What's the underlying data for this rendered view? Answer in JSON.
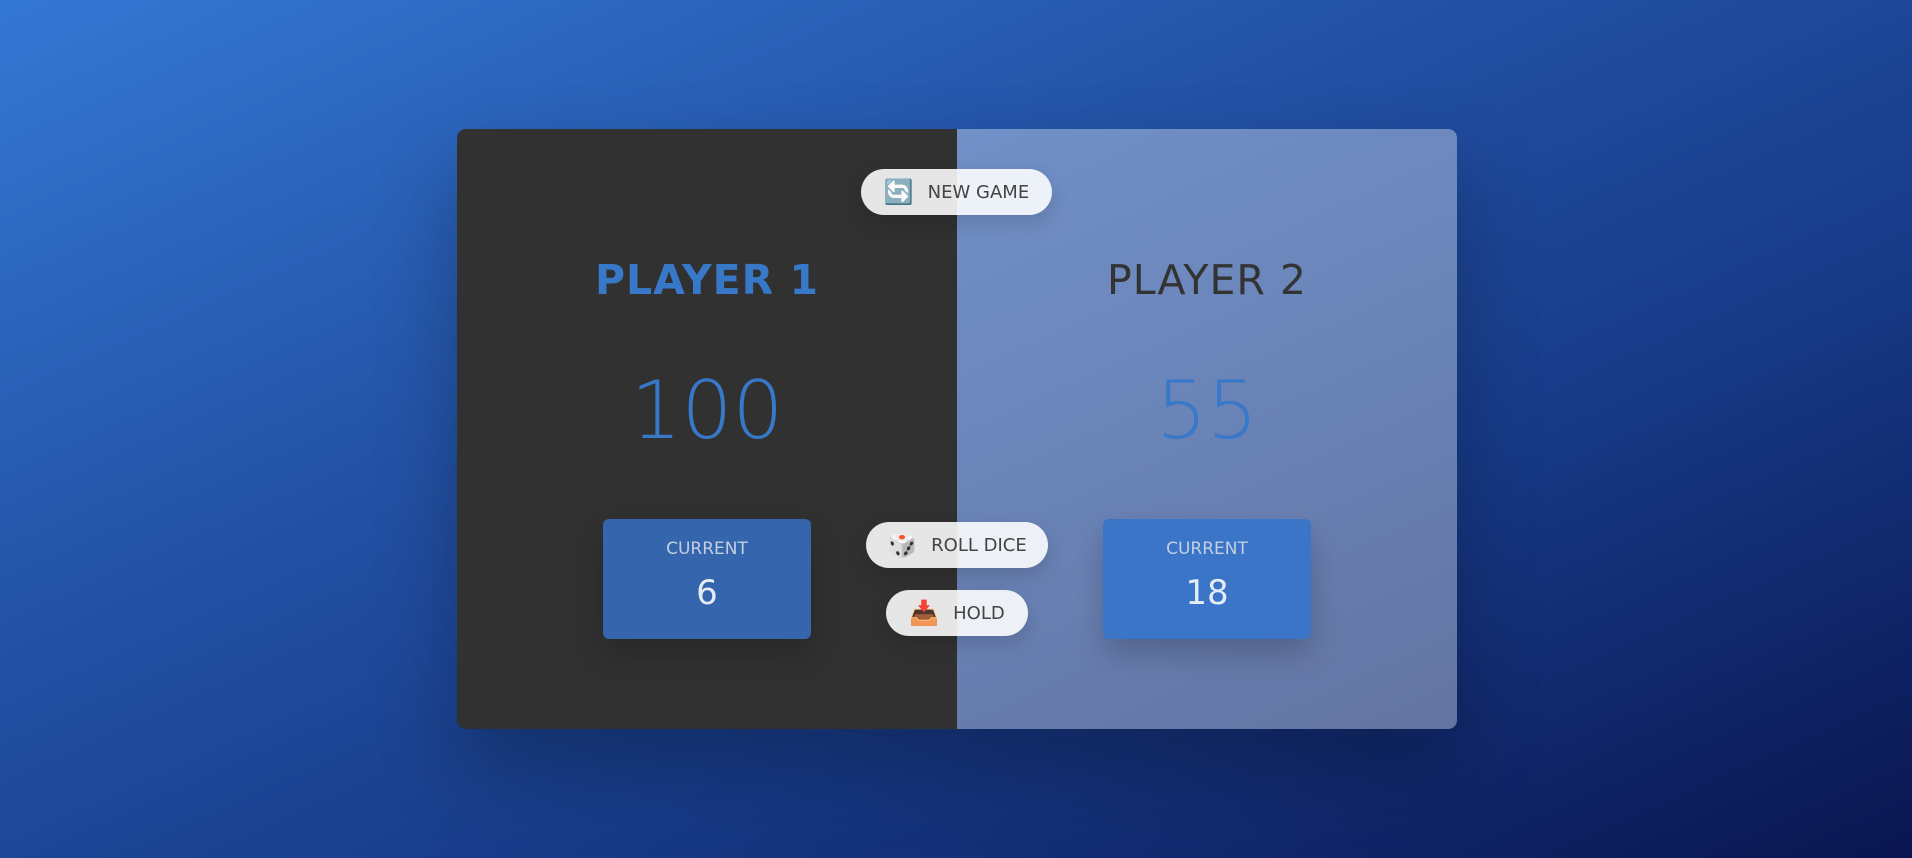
{
  "players": [
    {
      "name": "PLAYER 1",
      "score": "100",
      "current_label": "CURRENT",
      "current_score": "6",
      "active": false
    },
    {
      "name": "PLAYER 2",
      "score": "55",
      "current_label": "CURRENT",
      "current_score": "18",
      "active": true
    }
  ],
  "buttons": {
    "new_game": {
      "label": "NEW GAME",
      "icon": "🔄",
      "icon_name": "refresh-icon"
    },
    "roll_dice": {
      "label": "ROLL DICE",
      "icon": "🎲",
      "icon_name": "dice-icon"
    },
    "hold": {
      "label": "HOLD",
      "icon": "📥",
      "icon_name": "inbox-tray-icon"
    }
  },
  "colors": {
    "accent": "#3778c9",
    "panel_dark": "#313131",
    "current_box": "#3a75c8"
  }
}
